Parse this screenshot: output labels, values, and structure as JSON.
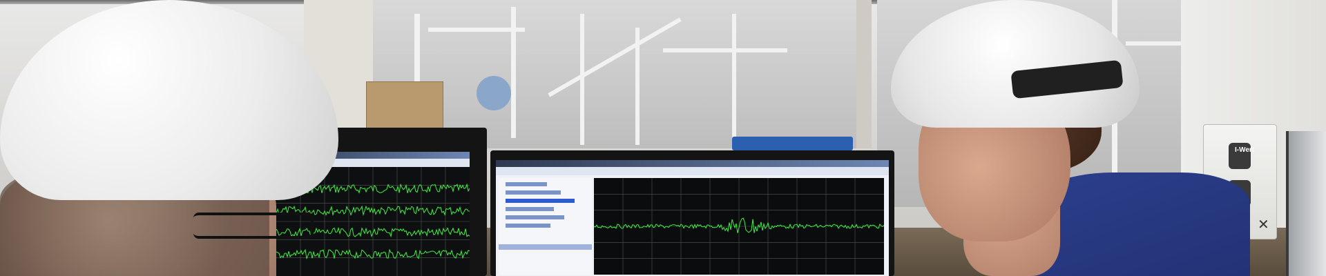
{
  "image": {
    "scene": "control-room-photo",
    "icons": [
      "hard-hat-icon",
      "monitor-icon",
      "waveform-icon",
      "power-icon",
      "info-icon",
      "tools-icon"
    ]
  },
  "plaque": {
    "label": "I-Wert",
    "glyphs": [
      "⏻",
      "i",
      "✕"
    ]
  },
  "left_monitor": {
    "chart_data": {
      "type": "line",
      "series": 4
    }
  },
  "center_monitor": {
    "chart_data": {
      "type": "line",
      "series": 1
    }
  },
  "colors": {
    "waveform": "#36f53a",
    "helmet": "#f4f4f4",
    "shirt": "#223276",
    "ui_accent": "#2e5ad1"
  }
}
